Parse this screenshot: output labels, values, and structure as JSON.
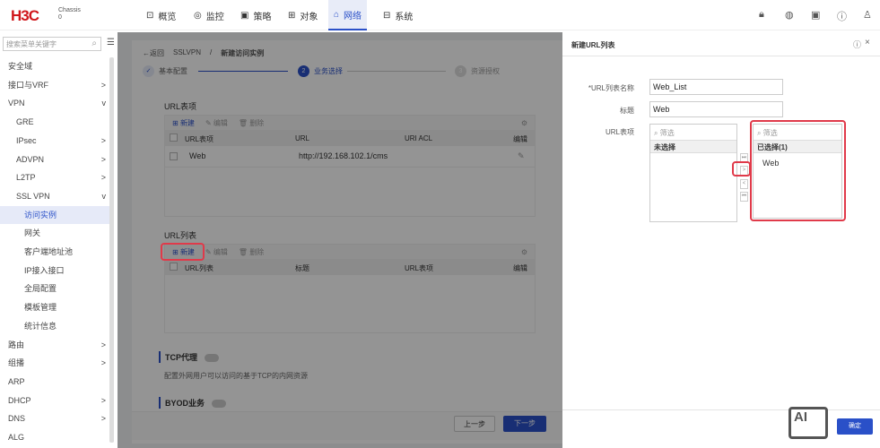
{
  "header": {
    "logo": "H3C",
    "device": "Chassis",
    "slot": "0",
    "nav": [
      {
        "icon": "monitor-icon",
        "glyph": "⊡",
        "label": "概览"
      },
      {
        "icon": "monitor-eye-icon",
        "glyph": "◎",
        "label": "监控"
      },
      {
        "icon": "policy-icon",
        "glyph": "▣",
        "label": "策略"
      },
      {
        "icon": "object-grid-icon",
        "glyph": "⊞",
        "label": "对象"
      },
      {
        "icon": "network-icon",
        "glyph": "⌂",
        "label": "网络",
        "selected": true
      },
      {
        "icon": "system-icon",
        "glyph": "⊟",
        "label": "系统"
      }
    ],
    "tools": [
      "lock-icon",
      "palette-icon",
      "save-icon",
      "help-icon",
      "user-icon"
    ]
  },
  "sidebar": {
    "search_placeholder": "搜索菜单关键字",
    "items": [
      {
        "label": "安全域"
      },
      {
        "label": "接口与VRF",
        "chev": ">"
      },
      {
        "label": "VPN",
        "chev": "v"
      },
      {
        "label": "GRE",
        "level": 1
      },
      {
        "label": "IPsec",
        "level": 1,
        "chev": ">"
      },
      {
        "label": "ADVPN",
        "level": 1,
        "chev": ">"
      },
      {
        "label": "L2TP",
        "level": 1,
        "chev": ">"
      },
      {
        "label": "SSL VPN",
        "level": 1,
        "chev": "v"
      },
      {
        "label": "访问实例",
        "level": 2,
        "active": true
      },
      {
        "label": "网关",
        "level": 2
      },
      {
        "label": "客户端地址池",
        "level": 2
      },
      {
        "label": "IP接入接口",
        "level": 2
      },
      {
        "label": "全局配置",
        "level": 2
      },
      {
        "label": "模板管理",
        "level": 2
      },
      {
        "label": "统计信息",
        "level": 2
      },
      {
        "label": "路由",
        "chev": ">"
      },
      {
        "label": "组播",
        "chev": ">"
      },
      {
        "label": "ARP"
      },
      {
        "label": "DHCP",
        "chev": ">"
      },
      {
        "label": "DNS",
        "chev": ">"
      },
      {
        "label": "ALG"
      }
    ]
  },
  "main": {
    "back": "←返回",
    "crumb1": "SSLVPN",
    "sep": "/",
    "crumb2": "新建访问实例",
    "steps": [
      {
        "label": "基本配置",
        "mark": "✓"
      },
      {
        "label": "业务选择",
        "mark": "2"
      },
      {
        "label": "资源授权",
        "mark": "3"
      }
    ],
    "url_items": {
      "title": "URL表项",
      "toolbar": {
        "new": "新建",
        "edit": "编辑",
        "delete": "删除"
      },
      "columns": [
        "URL表项",
        "URL",
        "URI ACL",
        "编辑"
      ],
      "rows": [
        {
          "name": "Web",
          "url": "http://192.168.102.1/cms",
          "acl": ""
        }
      ]
    },
    "url_lists": {
      "title": "URL列表",
      "toolbar": {
        "new": "新建",
        "edit": "编辑",
        "delete": "删除"
      },
      "columns": [
        "URL列表",
        "标题",
        "URL表项",
        "编辑"
      ]
    },
    "tcp": {
      "title": "TCP代理",
      "desc": "配置外网用户可以访问的基于TCP的内网资源",
      "enabled": false
    },
    "byod": {
      "title": "BYOD业务",
      "enabled": false
    },
    "prev": "上一步",
    "next": "下一步"
  },
  "drawer": {
    "title": "新建URL列表",
    "name_label": "*URL列表名称",
    "name_value": "Web_List",
    "title_label": "标题",
    "title_value": "Web",
    "items_label": "URL表项",
    "left": {
      "filter": "筛选",
      "header": "未选择"
    },
    "right": {
      "filter": "筛选",
      "header": "已选择(1)",
      "items": [
        "Web"
      ]
    },
    "arrows": [
      "⏭",
      ">",
      "<",
      "⏮"
    ],
    "ok": "确定"
  },
  "watermark": "AI 树叶云",
  "colors": {
    "accent": "#2a50c8",
    "brand": "#d0161b",
    "highlight": "#e03a4a"
  }
}
